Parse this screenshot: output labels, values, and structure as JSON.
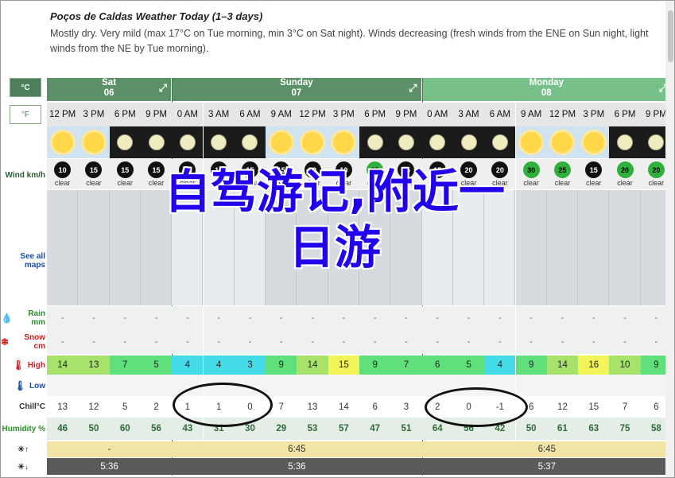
{
  "header": {
    "title": "Poços de Caldas Weather Today (1–3 days)",
    "description": "Mostly dry. Very mild (max 17°C on Tue morning, min 3°C on Sat night). Winds decreasing (fresh winds from the ENE on Sun night, light winds from the NE by Tue morning)."
  },
  "units": {
    "celsius": "°C",
    "fahrenheit": "°F"
  },
  "row_labels": {
    "wind": "Wind km/h",
    "see_all_maps": "See all maps",
    "rain": "Rain mm",
    "snow": "Snow cm",
    "high": "High",
    "low": "Low",
    "chill": "Chill°C",
    "humidity": "Humidity %"
  },
  "days": [
    {
      "name": "Sat",
      "date": "06",
      "span": 4,
      "highlight": false
    },
    {
      "name": "Sunday",
      "date": "07",
      "span": 8,
      "highlight": false
    },
    {
      "name": "Monday",
      "date": "08",
      "span": 8,
      "highlight": true
    }
  ],
  "times": [
    "12 PM",
    "3 PM",
    "6 PM",
    "9 PM",
    "0 AM",
    "3 AM",
    "6 AM",
    "9 AM",
    "12 PM",
    "3 PM",
    "6 PM",
    "9 PM",
    "0 AM",
    "3 AM",
    "6 AM",
    "9 AM",
    "12 PM",
    "3 PM",
    "6 PM",
    "9 PM"
  ],
  "sky": [
    "day",
    "day",
    "night",
    "night",
    "night",
    "night",
    "night",
    "day",
    "day",
    "day",
    "night",
    "night",
    "night",
    "night",
    "night",
    "day",
    "day",
    "day",
    "night",
    "night"
  ],
  "wind_speeds": [
    "10",
    "15",
    "15",
    "15",
    "10",
    "10",
    "15",
    "15",
    "10",
    "10",
    "25",
    "15",
    "15",
    "20",
    "20",
    "30",
    "25",
    "15",
    "20",
    "20"
  ],
  "wind_green": [
    false,
    false,
    false,
    false,
    false,
    false,
    false,
    false,
    false,
    false,
    true,
    false,
    false,
    false,
    false,
    true,
    true,
    false,
    true,
    true
  ],
  "wind_cond": [
    "clear",
    "clear",
    "clear",
    "clear",
    "clear",
    "clear",
    "clear",
    "clear",
    "clear",
    "clear",
    "clear",
    "clear",
    "clear",
    "clear",
    "clear",
    "clear",
    "clear",
    "clear",
    "clear",
    "clear"
  ],
  "rain": [
    "-",
    "-",
    "-",
    "-",
    "-",
    "-",
    "-",
    "-",
    "-",
    "-",
    "-",
    "-",
    "-",
    "-",
    "-",
    "-",
    "-",
    "-",
    "-",
    "-"
  ],
  "snow": [
    "-",
    "-",
    "-",
    "-",
    "-",
    "-",
    "-",
    "-",
    "-",
    "-",
    "-",
    "-",
    "-",
    "-",
    "-",
    "-",
    "-",
    "-",
    "-",
    "-"
  ],
  "high": [
    "14",
    "13",
    "7",
    "5",
    "4",
    "4",
    "3",
    "9",
    "14",
    "15",
    "9",
    "7",
    "6",
    "5",
    "4",
    "9",
    "14",
    "16",
    "10",
    "9"
  ],
  "high_colors": [
    "#a7e26b",
    "#a7e26b",
    "#5fe07a",
    "#5fe07a",
    "#43dbe8",
    "#43dbe8",
    "#43dbe8",
    "#5fe07a",
    "#a7e26b",
    "#f3f35a",
    "#5fe07a",
    "#5fe07a",
    "#5fe07a",
    "#5fe07a",
    "#43dbe8",
    "#5fe07a",
    "#a7e26b",
    "#f3f35a",
    "#a7e26b",
    "#5fe07a"
  ],
  "chill": [
    "13",
    "12",
    "5",
    "2",
    "1",
    "1",
    "0",
    "7",
    "13",
    "14",
    "6",
    "3",
    "2",
    "0",
    "-1",
    "6",
    "12",
    "15",
    "7",
    "6"
  ],
  "humidity": [
    "46",
    "50",
    "60",
    "56",
    "43",
    "31",
    "30",
    "29",
    "53",
    "57",
    "47",
    "51",
    "64",
    "56",
    "42",
    "50",
    "61",
    "63",
    "75",
    "58"
  ],
  "sunrise": {
    "sat": "-",
    "sun": "6:45",
    "mon": "6:45"
  },
  "sunset": {
    "sat": "5:36",
    "sun": "5:36",
    "mon": "5:37"
  },
  "dash": "-",
  "overlay_text": {
    "line1": "自驾游记,附近一",
    "line2": "日游"
  }
}
